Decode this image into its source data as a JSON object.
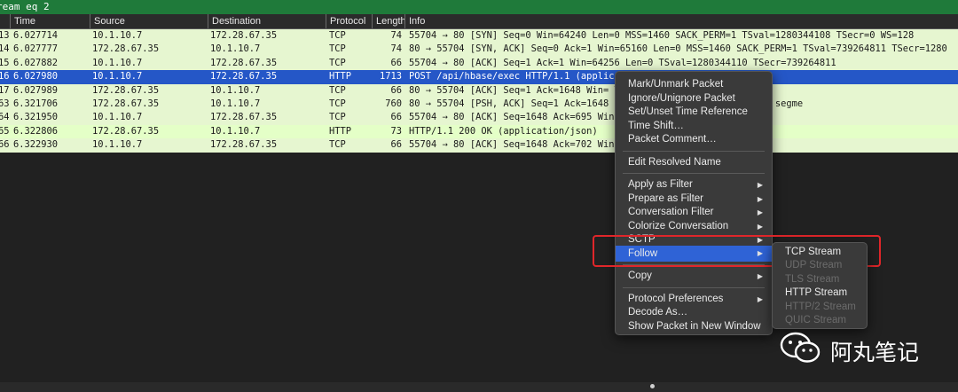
{
  "filter": {
    "text": "ream eq 2"
  },
  "columns": [
    "Time",
    "Source",
    "Destination",
    "Protocol",
    "Length",
    "Info"
  ],
  "packets": [
    {
      "no": "13",
      "time": "6.027714",
      "src": "10.1.10.7",
      "dst": "172.28.67.35",
      "proto": "TCP",
      "len": "74",
      "info": "55704 → 80 [SYN] Seq=0 Win=64240 Len=0 MSS=1460 SACK_PERM=1 TSval=1280344108 TSecr=0 WS=128",
      "kind": "tcp"
    },
    {
      "no": "14",
      "time": "6.027777",
      "src": "172.28.67.35",
      "dst": "10.1.10.7",
      "proto": "TCP",
      "len": "74",
      "info": "80 → 55704 [SYN, ACK] Seq=0 Ack=1 Win=65160 Len=0 MSS=1460 SACK_PERM=1 TSval=739264811 TSecr=1280",
      "kind": "tcp"
    },
    {
      "no": "15",
      "time": "6.027882",
      "src": "10.1.10.7",
      "dst": "172.28.67.35",
      "proto": "TCP",
      "len": "66",
      "info": "55704 → 80 [ACK] Seq=1 Ack=1 Win=64256 Len=0 TSval=1280344110 TSecr=739264811",
      "kind": "tcp"
    },
    {
      "no": "16",
      "time": "6.027980",
      "src": "10.1.10.7",
      "dst": "172.28.67.35",
      "proto": "HTTP",
      "len": "1713",
      "info": "POST /api/hbase/exec HTTP/1.1  (application/json)",
      "kind": "sel"
    },
    {
      "no": "17",
      "time": "6.027989",
      "src": "172.28.67.35",
      "dst": "10.1.10.7",
      "proto": "TCP",
      "len": "66",
      "info": "80 → 55704 [ACK] Seq=1 Ack=1648 Win=                        TSecr=1280344110",
      "kind": "tcp"
    },
    {
      "no": "63",
      "time": "6.321706",
      "src": "172.28.67.35",
      "dst": "10.1.10.7",
      "proto": "TCP",
      "len": "760",
      "info": "80 → 55704 [PSH, ACK] Seq=1 Ack=1648                       265105 TSecr=1280344110 [TCP segme",
      "kind": "tcp"
    },
    {
      "no": "64",
      "time": "6.321950",
      "src": "10.1.10.7",
      "dst": "172.28.67.35",
      "proto": "TCP",
      "len": "66",
      "info": "55704 → 80 [ACK] Seq=1648 Ack=695 Win                       4 TSecr=739265105",
      "kind": "tcp"
    },
    {
      "no": "65",
      "time": "6.322806",
      "src": "172.28.67.35",
      "dst": "10.1.10.7",
      "proto": "HTTP",
      "len": "73",
      "info": "HTTP/1.1 200 OK  (application/json)",
      "kind": "http"
    },
    {
      "no": "66",
      "time": "6.322930",
      "src": "10.1.10.7",
      "dst": "172.28.67.35",
      "proto": "TCP",
      "len": "66",
      "info": "55704 → 80 [ACK] Seq=1648 Ack=702 Win                       05 TSecr=739265106",
      "kind": "tcp"
    }
  ],
  "context_menu": [
    {
      "label": "Mark/Unmark Packet",
      "sub": false
    },
    {
      "label": "Ignore/Unignore Packet",
      "sub": false
    },
    {
      "label": "Set/Unset Time Reference",
      "sub": false
    },
    {
      "label": "Time Shift…",
      "sub": false
    },
    {
      "label": "Packet Comment…",
      "sub": false
    },
    {
      "sep": true
    },
    {
      "label": "Edit Resolved Name",
      "sub": false
    },
    {
      "sep": true
    },
    {
      "label": "Apply as Filter",
      "sub": true
    },
    {
      "label": "Prepare as Filter",
      "sub": true
    },
    {
      "label": "Conversation Filter",
      "sub": true
    },
    {
      "label": "Colorize Conversation",
      "sub": true
    },
    {
      "label": "SCTP",
      "sub": true
    },
    {
      "label": "Follow",
      "sub": true,
      "highlight": true
    },
    {
      "sep": true
    },
    {
      "label": "Copy",
      "sub": true
    },
    {
      "sep": true
    },
    {
      "label": "Protocol Preferences",
      "sub": true
    },
    {
      "label": "Decode As…",
      "sub": false
    },
    {
      "label": "Show Packet in New Window",
      "sub": false
    }
  ],
  "follow_submenu": [
    {
      "label": "TCP Stream",
      "enabled": true
    },
    {
      "label": "UDP Stream",
      "enabled": false
    },
    {
      "label": "TLS Stream",
      "enabled": false
    },
    {
      "label": "HTTP Stream",
      "enabled": true
    },
    {
      "label": "HTTP/2 Stream",
      "enabled": false
    },
    {
      "label": "QUIC Stream",
      "enabled": false
    }
  ],
  "watermark": {
    "text": "阿丸笔记"
  },
  "colors": {
    "selected": "#2557c7",
    "tcp_row": "#e6f6d0",
    "http_row": "#e4ffc7",
    "highlight_box": "#e0262a",
    "filter_bar": "#1f7a3a"
  }
}
